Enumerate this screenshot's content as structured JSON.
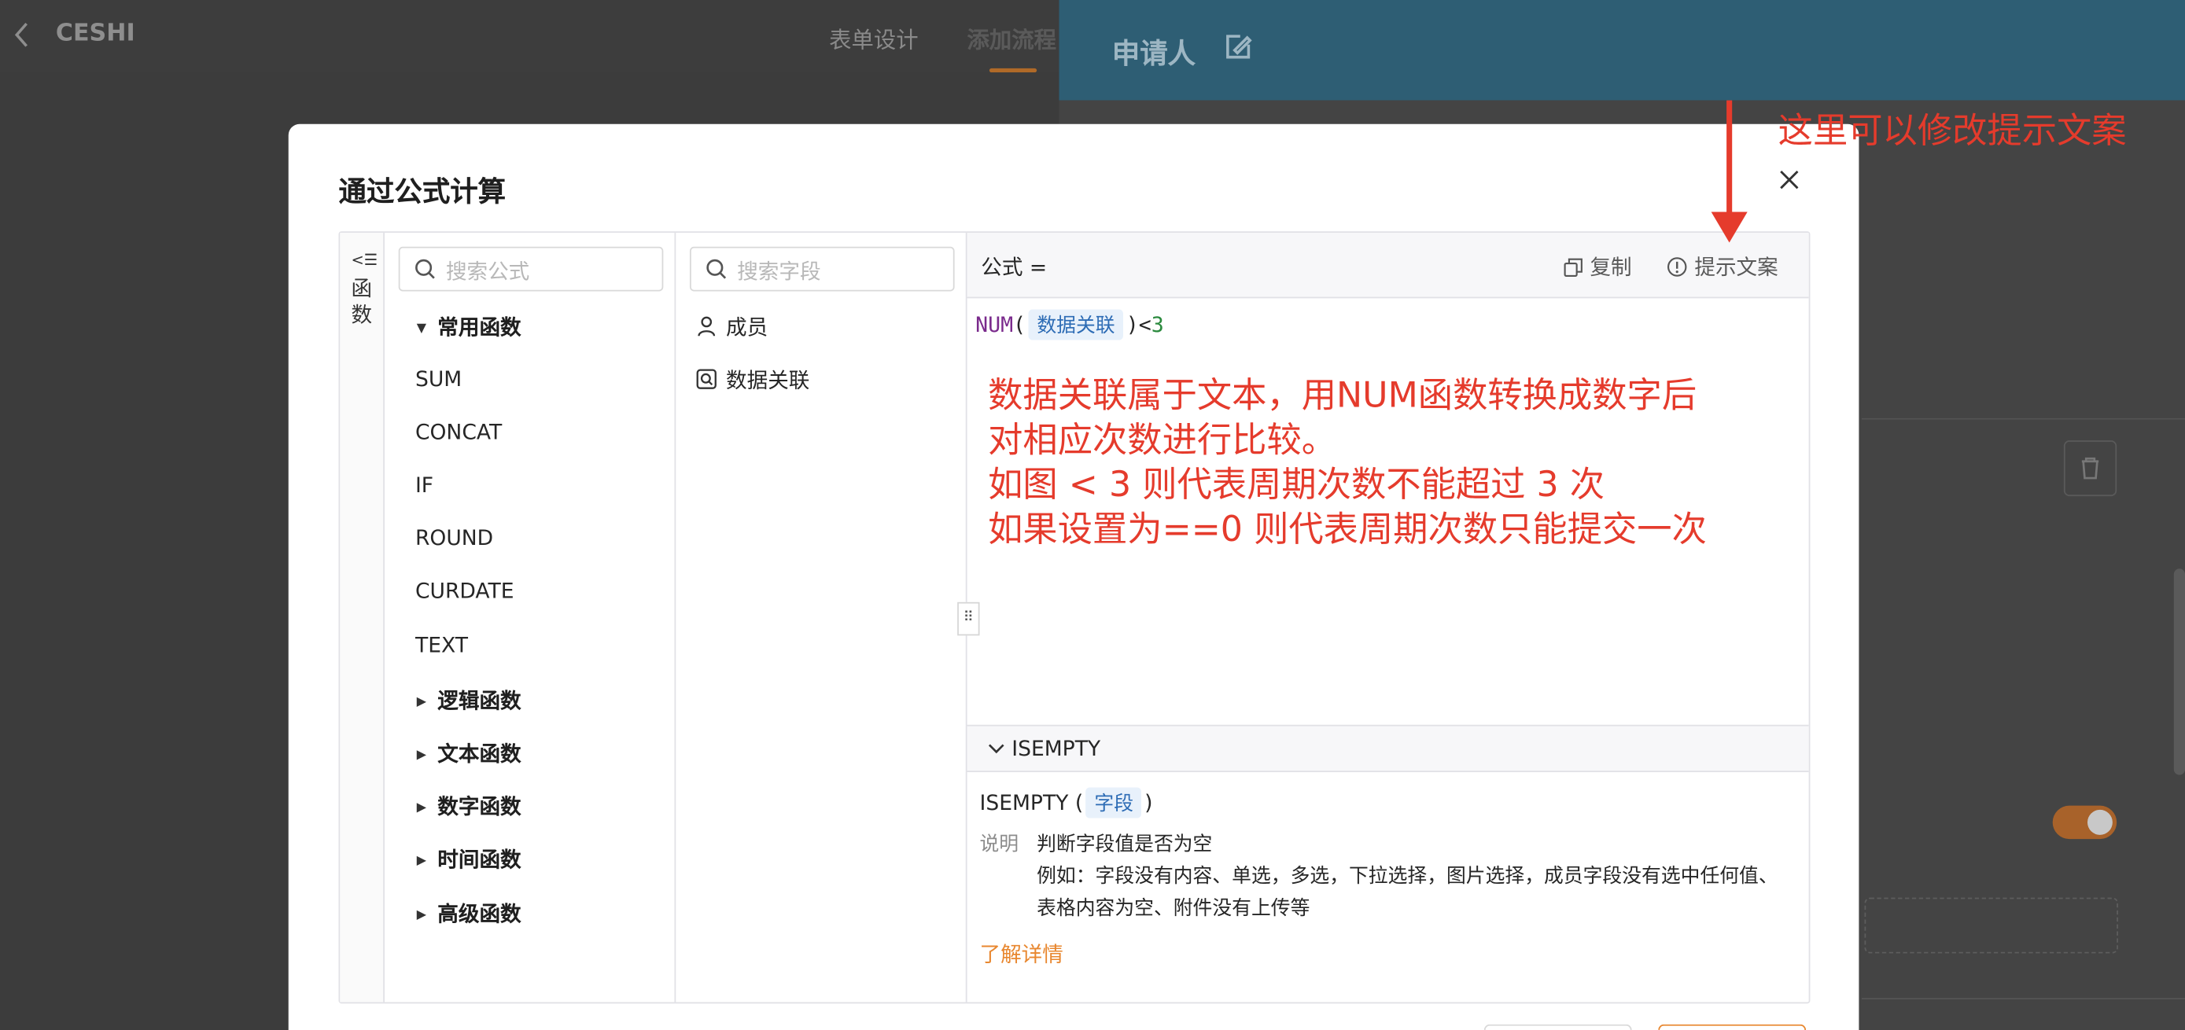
{
  "app": {
    "title": "CESHI",
    "tabs": [
      {
        "label": "表单设计"
      },
      {
        "label": "添加流程"
      }
    ],
    "right_panel_title": "申请人"
  },
  "annotations": {
    "top_right": "这里可以修改提示文案",
    "formula_note": [
      "数据关联属于文本，用NUM函数转换成数字后",
      "对相应次数进行比较。",
      "如图 < 3 则代表周期次数不能超过 3 次",
      "如果设置为==0 则代表周期次数只能提交一次"
    ]
  },
  "modal": {
    "title": "通过公式计算",
    "function_rail_label": "函数",
    "function_search_placeholder": "搜索公式",
    "field_search_placeholder": "搜索字段",
    "function_groups": {
      "common": {
        "label": "常用函数",
        "items": [
          "SUM",
          "CONCAT",
          "IF",
          "ROUND",
          "CURDATE",
          "TEXT"
        ]
      },
      "collapsed": [
        "逻辑函数",
        "文本函数",
        "数字函数",
        "时间函数",
        "高级函数"
      ]
    },
    "fields": [
      {
        "label": "成员",
        "icon": "person-icon"
      },
      {
        "label": "数据关联",
        "icon": "data-link-icon"
      }
    ],
    "formula": {
      "label": "公式 =",
      "copy_label": "复制",
      "hint_label": "提示文案",
      "code": {
        "func": "NUM",
        "open": "(",
        "field_chip": "数据关联",
        "close": ")",
        "operator": "<",
        "number": "3"
      }
    },
    "doc": {
      "header": "ISEMPTY",
      "signature_name": "ISEMPTY (",
      "signature_chip": "字段",
      "signature_close": ")",
      "desc_label": "说明",
      "desc_line1": "判断字段值是否为空",
      "desc_line2": "例如：字段没有内容、单选，多选，下拉选择，图片选择，成员字段没有选中任何值、表格内容为空、附件没有上传等",
      "link": "了解详情"
    }
  },
  "colors": {
    "accent": "#e8872f",
    "annotation": "#e53b2c",
    "chip_bg": "#e8f1fb",
    "chip_text": "#2d6cb5"
  }
}
